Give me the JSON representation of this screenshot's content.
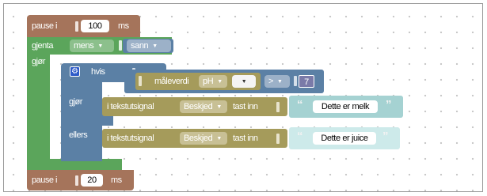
{
  "workspace": {
    "pause_top": {
      "keyword": "pause i",
      "value": "100",
      "unit": "ms"
    },
    "repeat": {
      "keyword": "gjenta",
      "mode": "mens",
      "condition": "sann",
      "do_label": "gjør"
    },
    "if_block": {
      "keyword": "hvis",
      "compare": {
        "sensor_label": "måleverdi",
        "sensor": "pH",
        "port": "",
        "operator": ">",
        "value": "7"
      },
      "then_label": "gjør",
      "else_label": "ellers",
      "then_action": {
        "prefix": "i tekstutsignal",
        "signal": "Beskjed",
        "suffix": "tast inn",
        "text": "Dette er melk"
      },
      "else_action": {
        "prefix": "i tekstutsignal",
        "signal": "Beskjed",
        "suffix": "tast inn",
        "text": "Dette er juice"
      }
    },
    "pause_bottom": {
      "keyword": "pause i",
      "value": "20",
      "unit": "ms"
    }
  },
  "colors": {
    "pause": "#a5745b",
    "loop": "#5ba55b",
    "logic": "#5b80a5",
    "sensor": "#a59b5b",
    "text": "#5ba5a5"
  },
  "icons": {
    "mutator": "gear-icon",
    "open_quote": "quote-open-icon",
    "close_quote": "quote-close-icon"
  }
}
